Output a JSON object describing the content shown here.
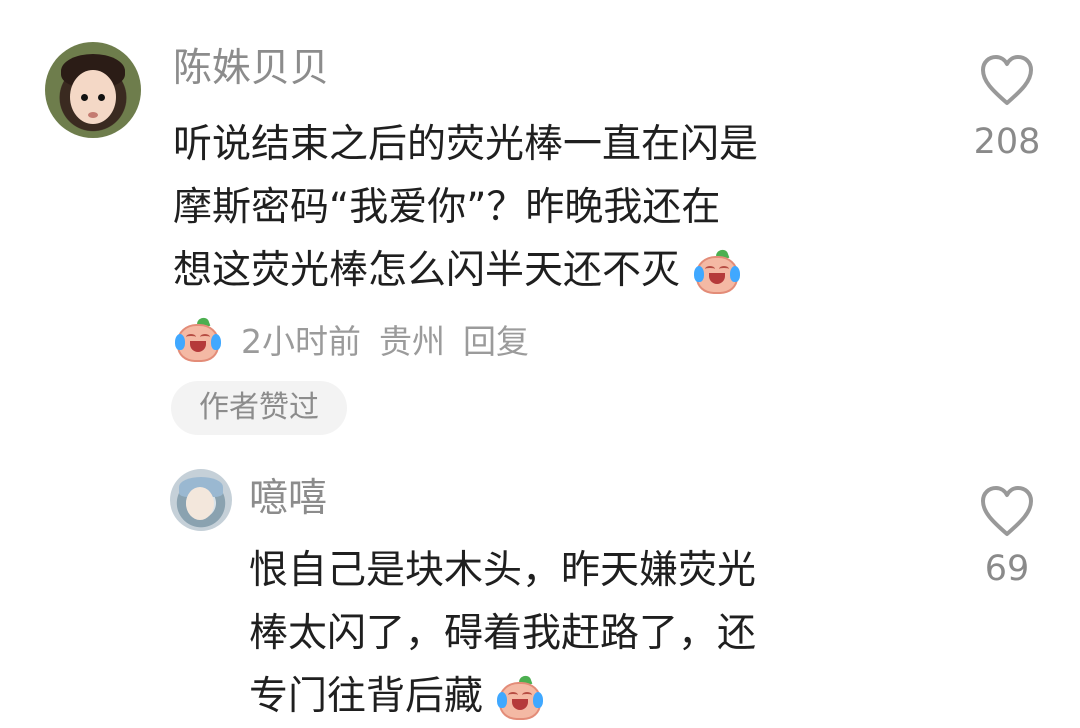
{
  "comments": {
    "main": {
      "username": "陈姝贝贝",
      "text_lines": [
        "听说结束之后的荧光棒一直在闪是",
        "摩斯密码“我爱你”？昨晚我还在",
        "想这荧光棒怎么闪半天还不灭"
      ],
      "meta": {
        "time": "2小时前",
        "location": "贵州",
        "reply": "回复"
      },
      "author_badge": "作者赞过",
      "like_count": "208"
    },
    "reply": {
      "username": "噫嘻",
      "text_lines": [
        "恨自己是块木头，昨天嫌荧光",
        "棒太闪了，碍着我赶路了，还",
        "专门往背后藏"
      ],
      "like_count": "69"
    }
  },
  "icons": {
    "like": "heart-outline-icon",
    "emoji": "crying-laughing-sticker-icon"
  },
  "colors": {
    "text": "#1f1f1f",
    "muted": "#8c8c8c",
    "badge_bg": "#f3f3f3",
    "emoji_tear": "#40a8ff"
  }
}
